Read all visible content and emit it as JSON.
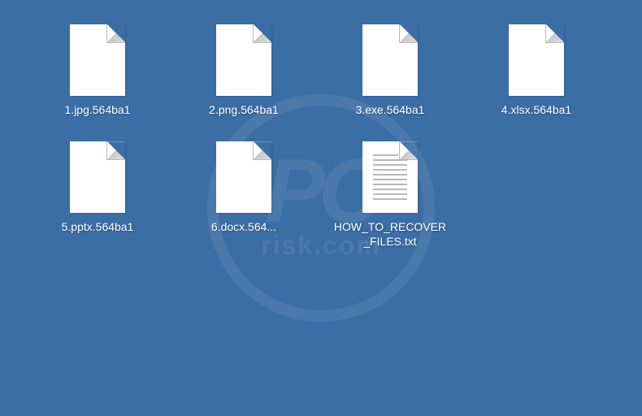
{
  "desktop": {
    "files": [
      {
        "name": "1.jpg.564ba1",
        "type": "blank"
      },
      {
        "name": "2.png.564ba1",
        "type": "blank"
      },
      {
        "name": "3.exe.564ba1",
        "type": "blank"
      },
      {
        "name": "4.xlsx.564ba1",
        "type": "blank"
      },
      {
        "name": "5.pptx.564ba1",
        "type": "blank"
      },
      {
        "name": "6.docx.564...",
        "type": "blank"
      },
      {
        "name": "HOW_TO_RECOVER_FILES.txt",
        "type": "txt"
      }
    ]
  },
  "watermark": {
    "logo": "PC",
    "text": "risk.com"
  }
}
